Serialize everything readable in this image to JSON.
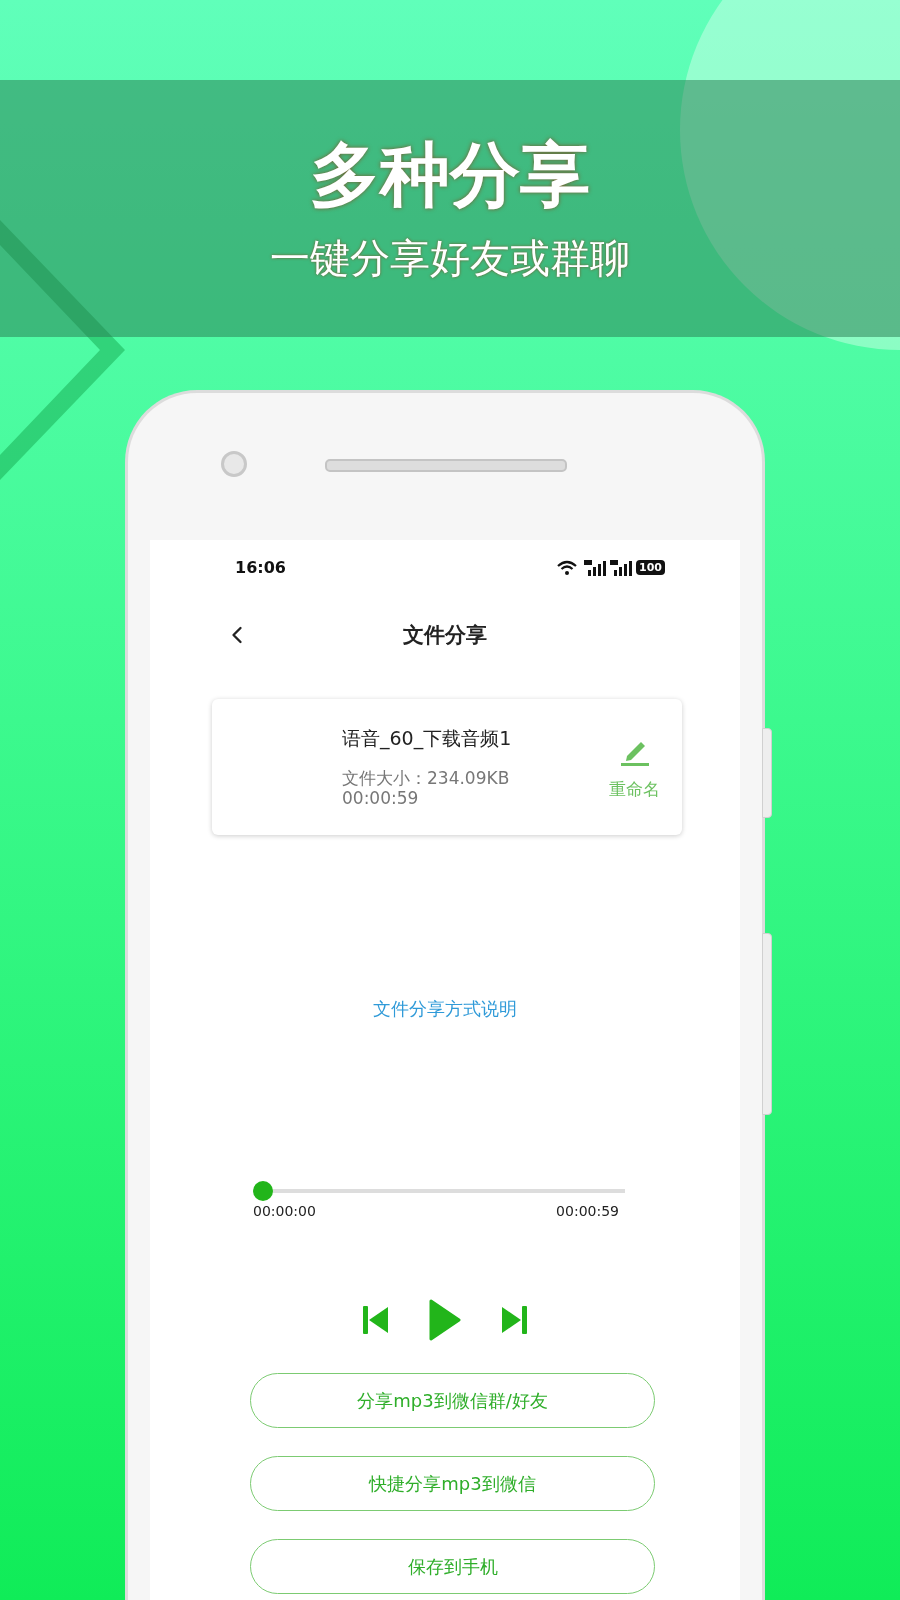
{
  "banner": {
    "title": "多种分享",
    "subtitle": "一键分享好友或群聊"
  },
  "status_bar": {
    "time": "16:06",
    "battery": "100"
  },
  "nav": {
    "title": "文件分享"
  },
  "file_card": {
    "name": "语音_60_下载音频1",
    "size": "文件大小：234.09KB",
    "duration": "00:00:59",
    "rename": "重命名"
  },
  "help_link": "文件分享方式说明",
  "player": {
    "level": 0,
    "current": "00:00:00",
    "total": "00:00:59"
  },
  "buttons": [
    {
      "label": "分享mp3到微信群/好友"
    },
    {
      "label": "快捷分享mp3到微信"
    },
    {
      "label": "保存到手机"
    }
  ]
}
